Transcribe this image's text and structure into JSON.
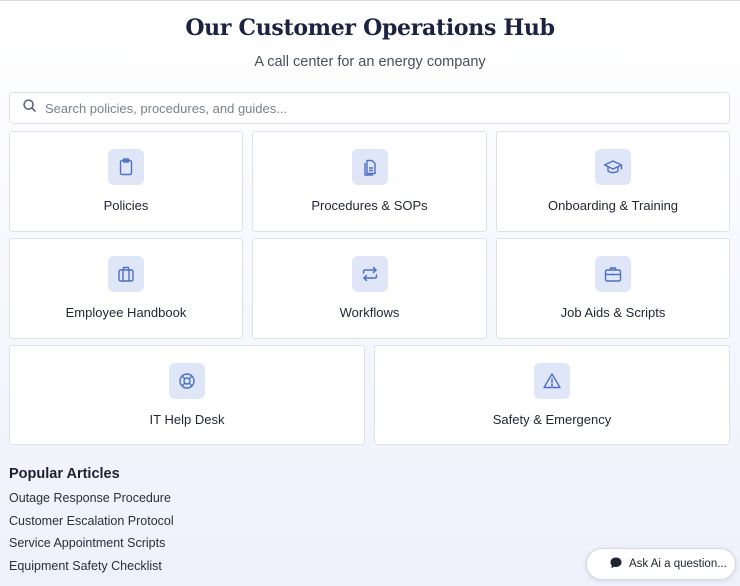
{
  "header": {
    "title": "Our Customer Operations Hub",
    "subtitle": "A call center for an energy company"
  },
  "search": {
    "placeholder": "Search policies, procedures, and guides...",
    "icon": "search-icon"
  },
  "cards": [
    {
      "label": "Policies",
      "icon": "clipboard-icon"
    },
    {
      "label": "Procedures & SOPs",
      "icon": "documents-icon"
    },
    {
      "label": "Onboarding & Training",
      "icon": "graduation-cap-icon"
    },
    {
      "label": "Employee Handbook",
      "icon": "luggage-icon"
    },
    {
      "label": "Workflows",
      "icon": "repeat-icon"
    },
    {
      "label": "Job Aids & Scripts",
      "icon": "briefcase-icon"
    },
    {
      "label": "IT Help Desk",
      "icon": "lifebuoy-icon"
    },
    {
      "label": "Safety & Emergency",
      "icon": "warning-triangle-icon"
    }
  ],
  "popular": {
    "title": "Popular Articles",
    "articles": [
      "Outage Response Procedure",
      "Customer Escalation Protocol",
      "Service Appointment Scripts",
      "Equipment Safety Checklist"
    ]
  },
  "ask_ai": {
    "label": "Ask Ai a question...",
    "icon": "chat-bubble-icon"
  },
  "colors": {
    "icon_tile": "#dfe6f7",
    "icon_stroke": "#4d6fc4",
    "title": "#1c2340"
  }
}
